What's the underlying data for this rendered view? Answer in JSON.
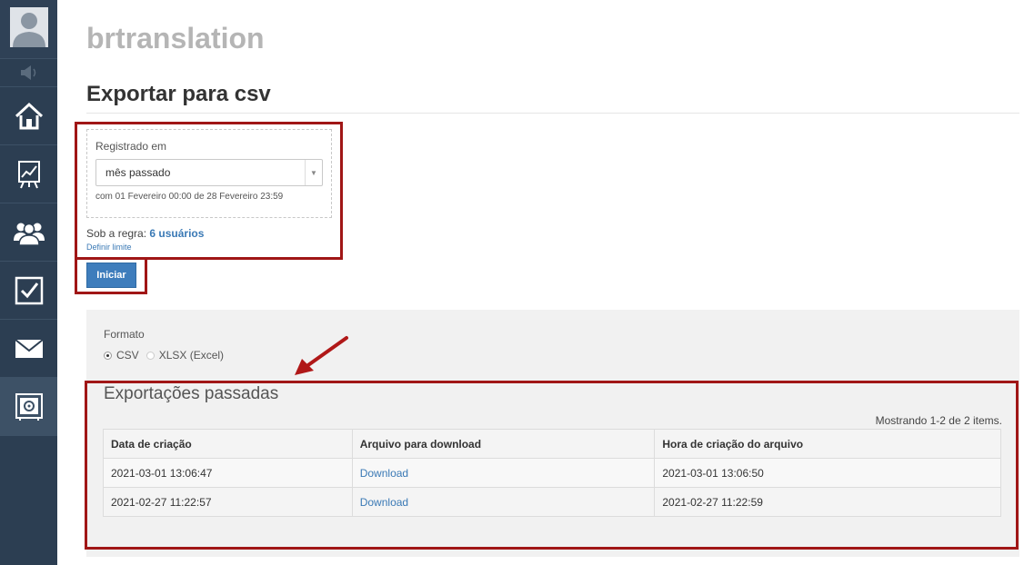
{
  "app": {
    "title": "brtranslation"
  },
  "page": {
    "title": "Exportar para csv"
  },
  "filter": {
    "label": "Registrado em",
    "selected": "mês passado",
    "date_range": "com 01 Fevereiro 00:00 de 28 Fevereiro 23:59"
  },
  "rule": {
    "prefix": "Sob a regra:",
    "count": "6 usuários",
    "limit_link": "Definir limite"
  },
  "actions": {
    "start_label": "Iniciar"
  },
  "format": {
    "label": "Formato",
    "options": [
      {
        "label": "CSV",
        "selected": true
      },
      {
        "label": "XLSX (Excel)",
        "selected": false
      }
    ]
  },
  "past_exports": {
    "title": "Exportações passadas",
    "summary": "Mostrando 1-2 de 2 items.",
    "columns": [
      "Data de criação",
      "Arquivo para download",
      "Hora de criação do arquivo"
    ],
    "rows": [
      {
        "created": "2021-03-01 13:06:47",
        "file": "Download",
        "file_time": "2021-03-01 13:06:50"
      },
      {
        "created": "2021-02-27 11:22:57",
        "file": "Download",
        "file_time": "2021-02-27 11:22:59"
      }
    ]
  },
  "colors": {
    "sidebar": "#2c3e52",
    "accent": "#3e7dbc",
    "highlight": "#a01616"
  }
}
